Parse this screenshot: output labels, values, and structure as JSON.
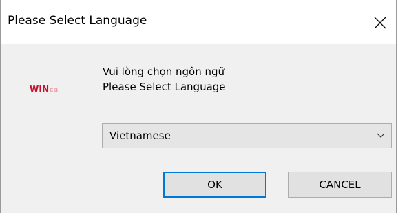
{
  "window": {
    "title": "Please Select Language",
    "close_icon": "close-x-icon"
  },
  "logo": {
    "win": "WIN",
    "ca": "ca",
    "brand_color": "#c8102e",
    "accent_color": "#e8a0a8"
  },
  "message": {
    "line1": "Vui lòng chọn ngôn ngữ",
    "line2": "Please Select Language"
  },
  "language_select": {
    "value": "Vietnamese",
    "arrow_icon": "chevron-down-icon"
  },
  "buttons": {
    "ok_label": "OK",
    "cancel_label": "CANCEL",
    "focus_color": "#0078d7"
  }
}
